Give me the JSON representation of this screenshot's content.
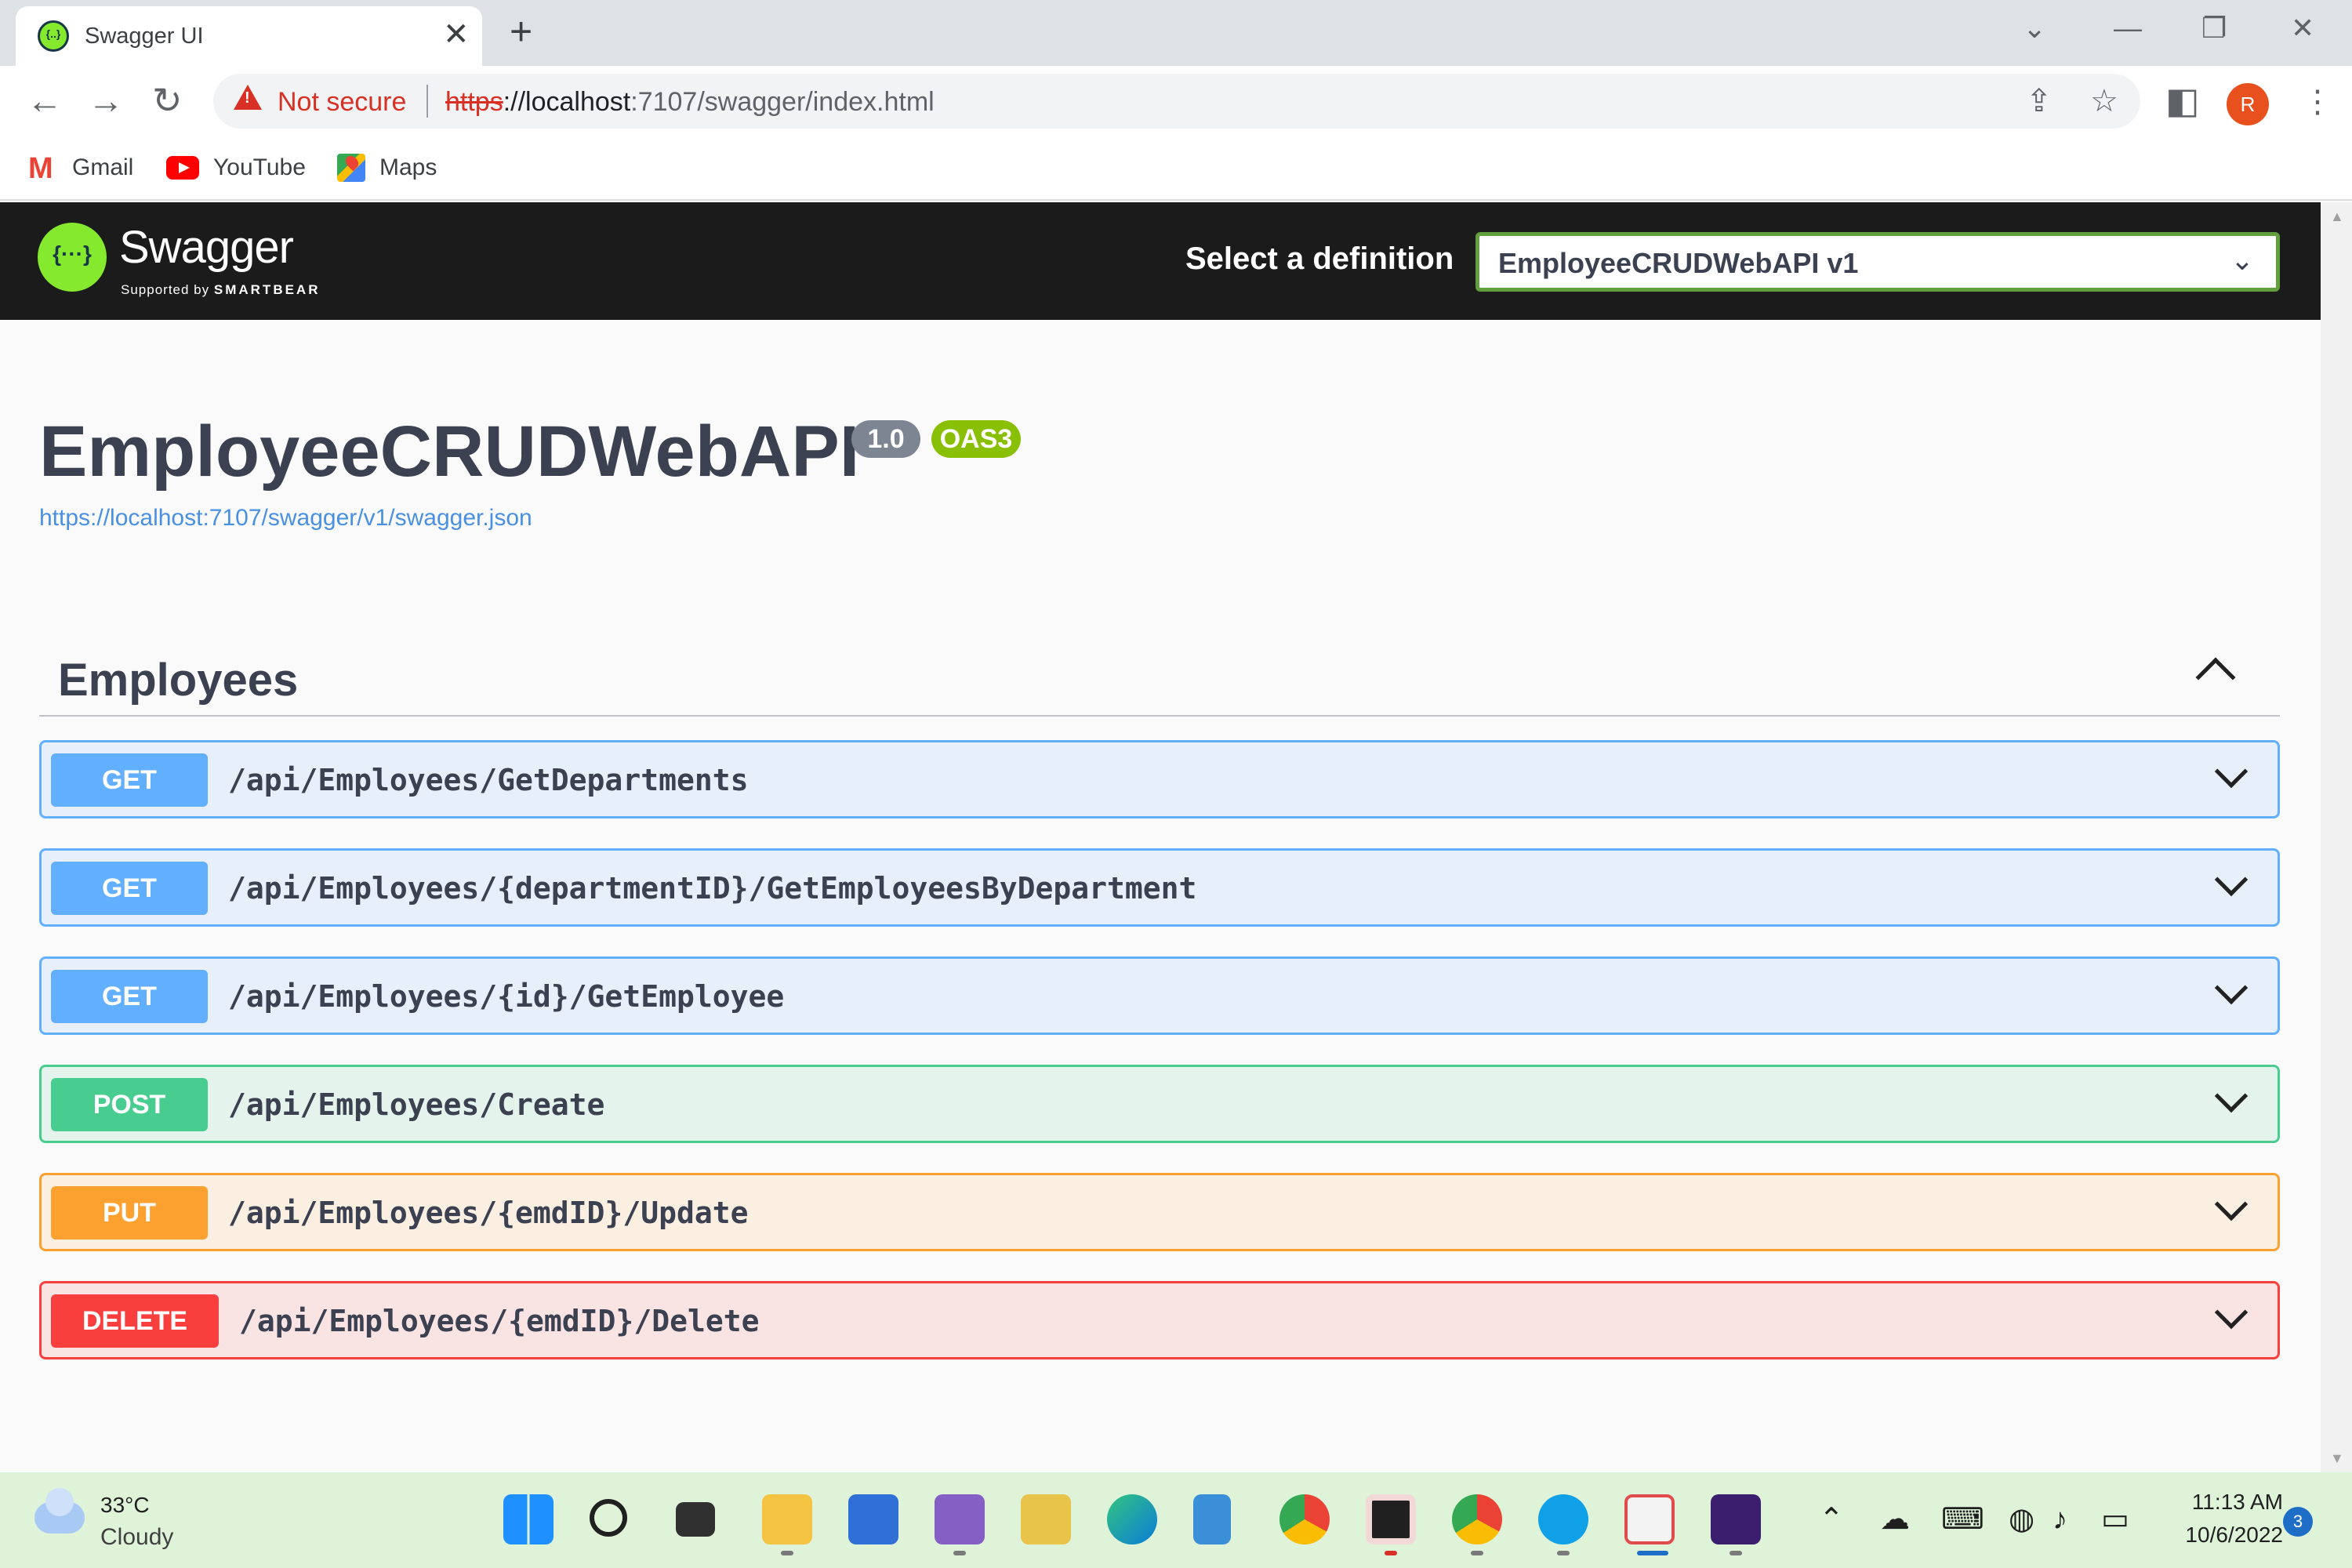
{
  "browser": {
    "tab_title": "Swagger UI",
    "tab_close": "✕",
    "new_tab": "+",
    "security_label": "Not secure",
    "url_scheme": "https",
    "url_host": "://localhost",
    "url_rest": ":7107/swagger/index.html",
    "profile_initial": "R",
    "bookmarks": [
      {
        "label": "Gmail"
      },
      {
        "label": "YouTube"
      },
      {
        "label": "Maps"
      }
    ]
  },
  "swagger": {
    "brand": "Swagger",
    "supported_prefix": "Supported by",
    "supported_brand": "SMARTBEAR",
    "select_label": "Select a definition",
    "selected_definition": "EmployeeCRUDWebAPI v1",
    "title": "EmployeeCRUDWebAPI",
    "version": "1.0",
    "oas": "OAS3",
    "spec_url": "https://localhost:7107/swagger/v1/swagger.json",
    "section": "Employees",
    "operations": [
      {
        "method": "GET",
        "path": "/api/Employees/GetDepartments"
      },
      {
        "method": "GET",
        "path": "/api/Employees/{departmentID}/GetEmployeesByDepartment"
      },
      {
        "method": "GET",
        "path": "/api/Employees/{id}/GetEmployee"
      },
      {
        "method": "POST",
        "path": "/api/Employees/Create"
      },
      {
        "method": "PUT",
        "path": "/api/Employees/{emdID}/Update"
      },
      {
        "method": "DELETE",
        "path": "/api/Employees/{emdID}/Delete"
      }
    ]
  },
  "colors": {
    "get": "#61affe",
    "post": "#49cc90",
    "put": "#fca130",
    "delete": "#f93e3e",
    "topbar": "#1b1b1b",
    "swagger_green": "#85ea2d"
  },
  "taskbar": {
    "temperature": "33°C",
    "weather": "Cloudy",
    "time": "11:13 AM",
    "date": "10/6/2022",
    "notifications": "3"
  }
}
